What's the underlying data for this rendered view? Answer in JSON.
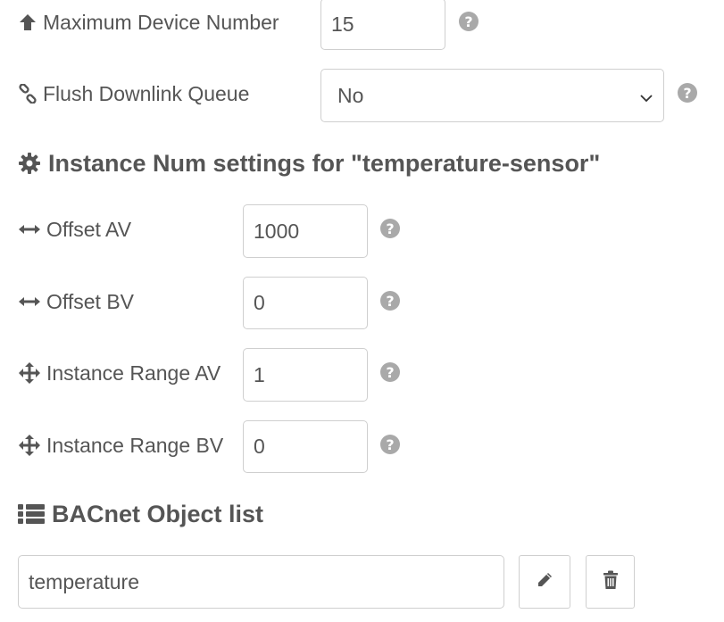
{
  "fields": {
    "max_device_number": {
      "label": "Maximum Device Number",
      "value": "15",
      "icon": "arrow-up-icon"
    },
    "flush_downlink_queue": {
      "label": "Flush Downlink Queue",
      "value": "No",
      "icon": "link-icon"
    }
  },
  "instance_section": {
    "title": "Instance Num settings for \"temperature-sensor\"",
    "icon": "gear-icon",
    "offset_av": {
      "label": "Offset AV",
      "value": "1000",
      "icon": "arrows-horizontal-icon"
    },
    "offset_bv": {
      "label": "Offset BV",
      "value": "0",
      "icon": "arrows-horizontal-icon"
    },
    "instance_range_av": {
      "label": "Instance Range AV",
      "value": "1",
      "icon": "arrows-move-icon"
    },
    "instance_range_bv": {
      "label": "Instance Range BV",
      "value": "0",
      "icon": "arrows-move-icon"
    }
  },
  "object_list": {
    "title": "BACnet Object list",
    "icon": "list-icon",
    "items": [
      {
        "value": "temperature"
      }
    ]
  },
  "help_glyph": "?",
  "colors": {
    "text": "#555555",
    "border": "#cfcfcf",
    "help_icon": "#a9a9a9"
  }
}
